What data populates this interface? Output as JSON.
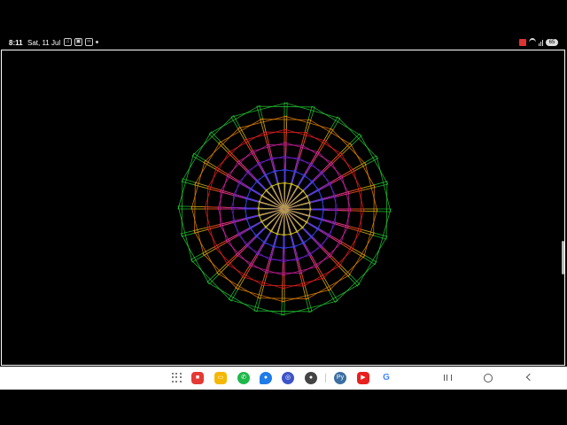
{
  "status_bar": {
    "time": "8:11",
    "date": "Sat, 11 Jul",
    "battery": "65"
  },
  "drawing": {
    "description_colors": [
      "#22cc33",
      "#ee8800",
      "#ee2222",
      "#dd22aa",
      "#7722dd",
      "#3344ee",
      "#ddcc11"
    ],
    "background": "#000000"
  },
  "taskbar": {
    "apps": [
      {
        "name": "app-drawer",
        "color": "#555555"
      },
      {
        "name": "flipboard",
        "color": "#e53935",
        "glyph": "■"
      },
      {
        "name": "files",
        "color": "#f5b700",
        "glyph": "▭"
      },
      {
        "name": "phone",
        "color": "#1eb84a",
        "glyph": "✆"
      },
      {
        "name": "messages",
        "color": "#1e7be8",
        "glyph": "●"
      },
      {
        "name": "browser",
        "color": "#3d55c9",
        "glyph": "◎"
      },
      {
        "name": "camera",
        "color": "#444444",
        "glyph": "●"
      },
      {
        "name": "pydroid",
        "color": "#3b6fa3",
        "glyph": "Py"
      },
      {
        "name": "youtube",
        "color": "#e8201f",
        "glyph": "▶"
      },
      {
        "name": "google",
        "color": "#ffffff",
        "glyph": "G"
      }
    ]
  }
}
